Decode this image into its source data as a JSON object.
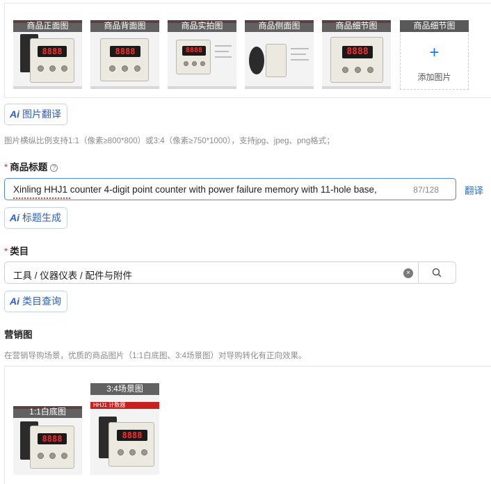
{
  "gallery": {
    "images": [
      {
        "caption": "商品正面图",
        "lcd": "8888"
      },
      {
        "caption": "商品背面图",
        "lcd": "8888"
      },
      {
        "caption": "商品实拍图",
        "lcd": "8888"
      },
      {
        "caption": "商品侧面图",
        "lcd": ""
      },
      {
        "caption": "商品细节图",
        "lcd": "8888"
      }
    ],
    "add_slot": {
      "caption": "商品细节图",
      "plus": "+",
      "label": "添加图片"
    }
  },
  "image_translate_button": {
    "icon": "Ai",
    "label": "图片翻译"
  },
  "image_hint": "图片横纵比例支持1:1（像素≥800*800）或3:4（像素≥750*1000），支持jpg、jpeg、png格式；",
  "title_section": {
    "required_mark": "*",
    "label": "商品标题",
    "help_icon": "?",
    "value": "Xinling HHJ1 counter 4-digit point counter with power failure memory with 11-hole base,",
    "counter": "87/128",
    "translate_link": "翻译",
    "generate_button": {
      "icon": "Ai",
      "label": "标题生成"
    }
  },
  "category_section": {
    "required_mark": "*",
    "label": "类目",
    "value": "工具 / 仪器仪表 / 配件与附件",
    "clear_icon": "×",
    "query_button": {
      "icon": "Ai",
      "label": "类目查询"
    }
  },
  "marketing_section": {
    "label": "营销图",
    "hint": "在营销导购场景，优质的商品图片（1:1白底图、3:4场景图）对导购转化有正向效果。",
    "images": [
      {
        "caption": "1:1白底图",
        "lcd": "8888"
      },
      {
        "caption": "3:4场景图",
        "lcd": "8888",
        "banner": "HHJ1 计数器"
      }
    ]
  },
  "colors": {
    "accent": "#1677ff",
    "ai_text": "#2d5fb7",
    "required": "#e53935",
    "lcd": "#ff2a2a"
  }
}
